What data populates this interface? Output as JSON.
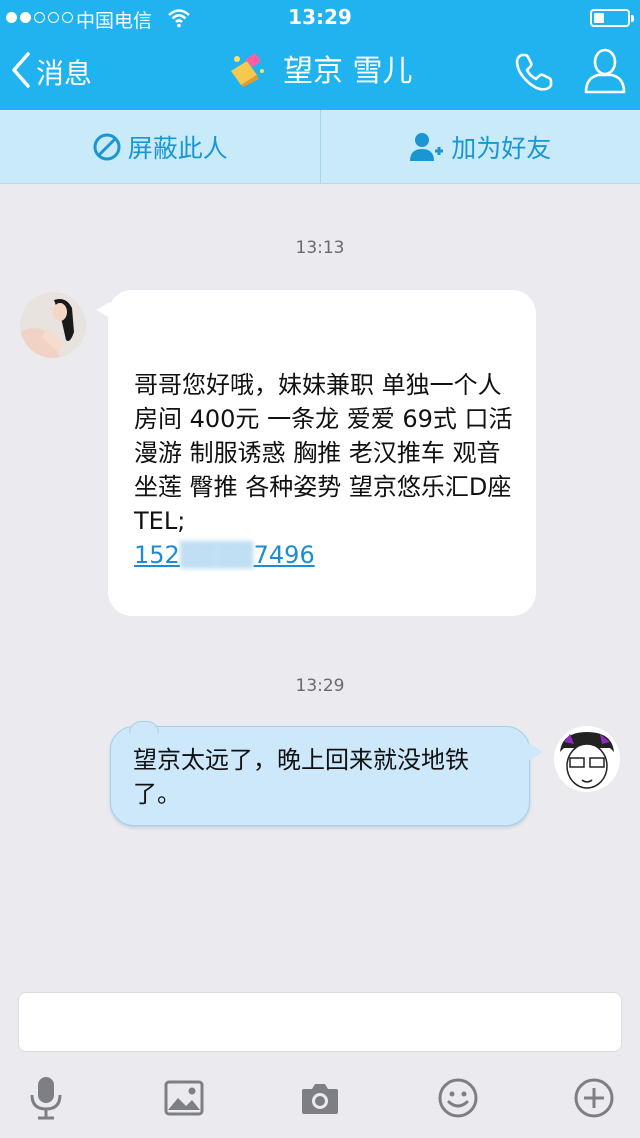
{
  "status_bar": {
    "carrier": "中国电信",
    "time": "13:29",
    "signal_bars_filled": 2,
    "signal_bars_total": 5,
    "battery_level": 0.3
  },
  "nav": {
    "back_label": "消息",
    "title": "望京 雪儿",
    "icons": [
      "chevron-left-icon",
      "phone-icon",
      "profile-icon"
    ]
  },
  "actions": {
    "block_label": "屏蔽此人",
    "add_friend_label": "加为好友"
  },
  "messages": [
    {
      "direction": "incoming",
      "timestamp": "13:13",
      "text": "哥哥您好哦，妹妹兼职 单独一个人房间 400元 一条龙 爱爱 69式 口活 漫游 制服诱惑 胸推 老汉推车 观音坐莲 臀推 各种姿势 望京悠乐汇D座 TEL;",
      "phone_visible_start": "152",
      "phone_visible_end": "7496"
    },
    {
      "direction": "outgoing",
      "timestamp": "13:29",
      "text": "望京太远了，晚上回来就没地铁了。"
    }
  ],
  "composer": {
    "placeholder": "",
    "toolbar_icons": [
      "microphone-icon",
      "image-icon",
      "camera-icon",
      "emoji-icon",
      "plus-icon"
    ]
  },
  "colors": {
    "header": "#20b3ef",
    "action_bar": "#c9eaf8",
    "link": "#1e8bd5",
    "outgoing_bubble": "#cde8fa",
    "background": "#ebebef"
  }
}
